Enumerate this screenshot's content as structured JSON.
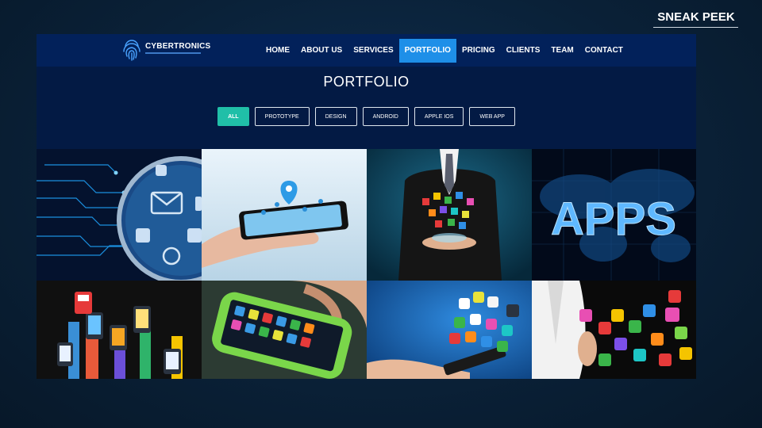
{
  "badge": {
    "label": "SNEAK PEEK"
  },
  "brand": {
    "name": "CYBERTRONICS"
  },
  "nav": {
    "items": [
      {
        "label": "HOME",
        "active": false
      },
      {
        "label": "ABOUT US",
        "active": false
      },
      {
        "label": "SERVICES",
        "active": false
      },
      {
        "label": "PORTFOLIO",
        "active": true
      },
      {
        "label": "PRICING",
        "active": false
      },
      {
        "label": "CLIENTS",
        "active": false
      },
      {
        "label": "TEAM",
        "active": false
      },
      {
        "label": "CONTACT",
        "active": false
      }
    ]
  },
  "portfolio": {
    "title": "PORTFOLIO",
    "filters": [
      {
        "label": "ALL",
        "active": true
      },
      {
        "label": "PROTOTYPE",
        "active": false
      },
      {
        "label": "DESIGN",
        "active": false
      },
      {
        "label": "ANDROID",
        "active": false
      },
      {
        "label": "APPLE IOS",
        "active": false
      },
      {
        "label": "WEB APP",
        "active": false
      }
    ],
    "tiles": [
      {
        "name": "portfolio-tile-circuit-magnifier"
      },
      {
        "name": "portfolio-tile-hand-smartphone-location"
      },
      {
        "name": "portfolio-tile-businessman-app-icons"
      },
      {
        "name": "portfolio-tile-apps-world-map",
        "text": "APPS"
      },
      {
        "name": "portfolio-tile-hands-holding-phones"
      },
      {
        "name": "portfolio-tile-green-smartphone"
      },
      {
        "name": "portfolio-tile-tablet-app-icons"
      },
      {
        "name": "portfolio-tile-hand-colorful-icons"
      }
    ]
  },
  "colors": {
    "nav_background": "#02215a",
    "nav_active": "#1e8fe8",
    "filter_active": "#20bfa8",
    "page_background": "#0a2138"
  }
}
